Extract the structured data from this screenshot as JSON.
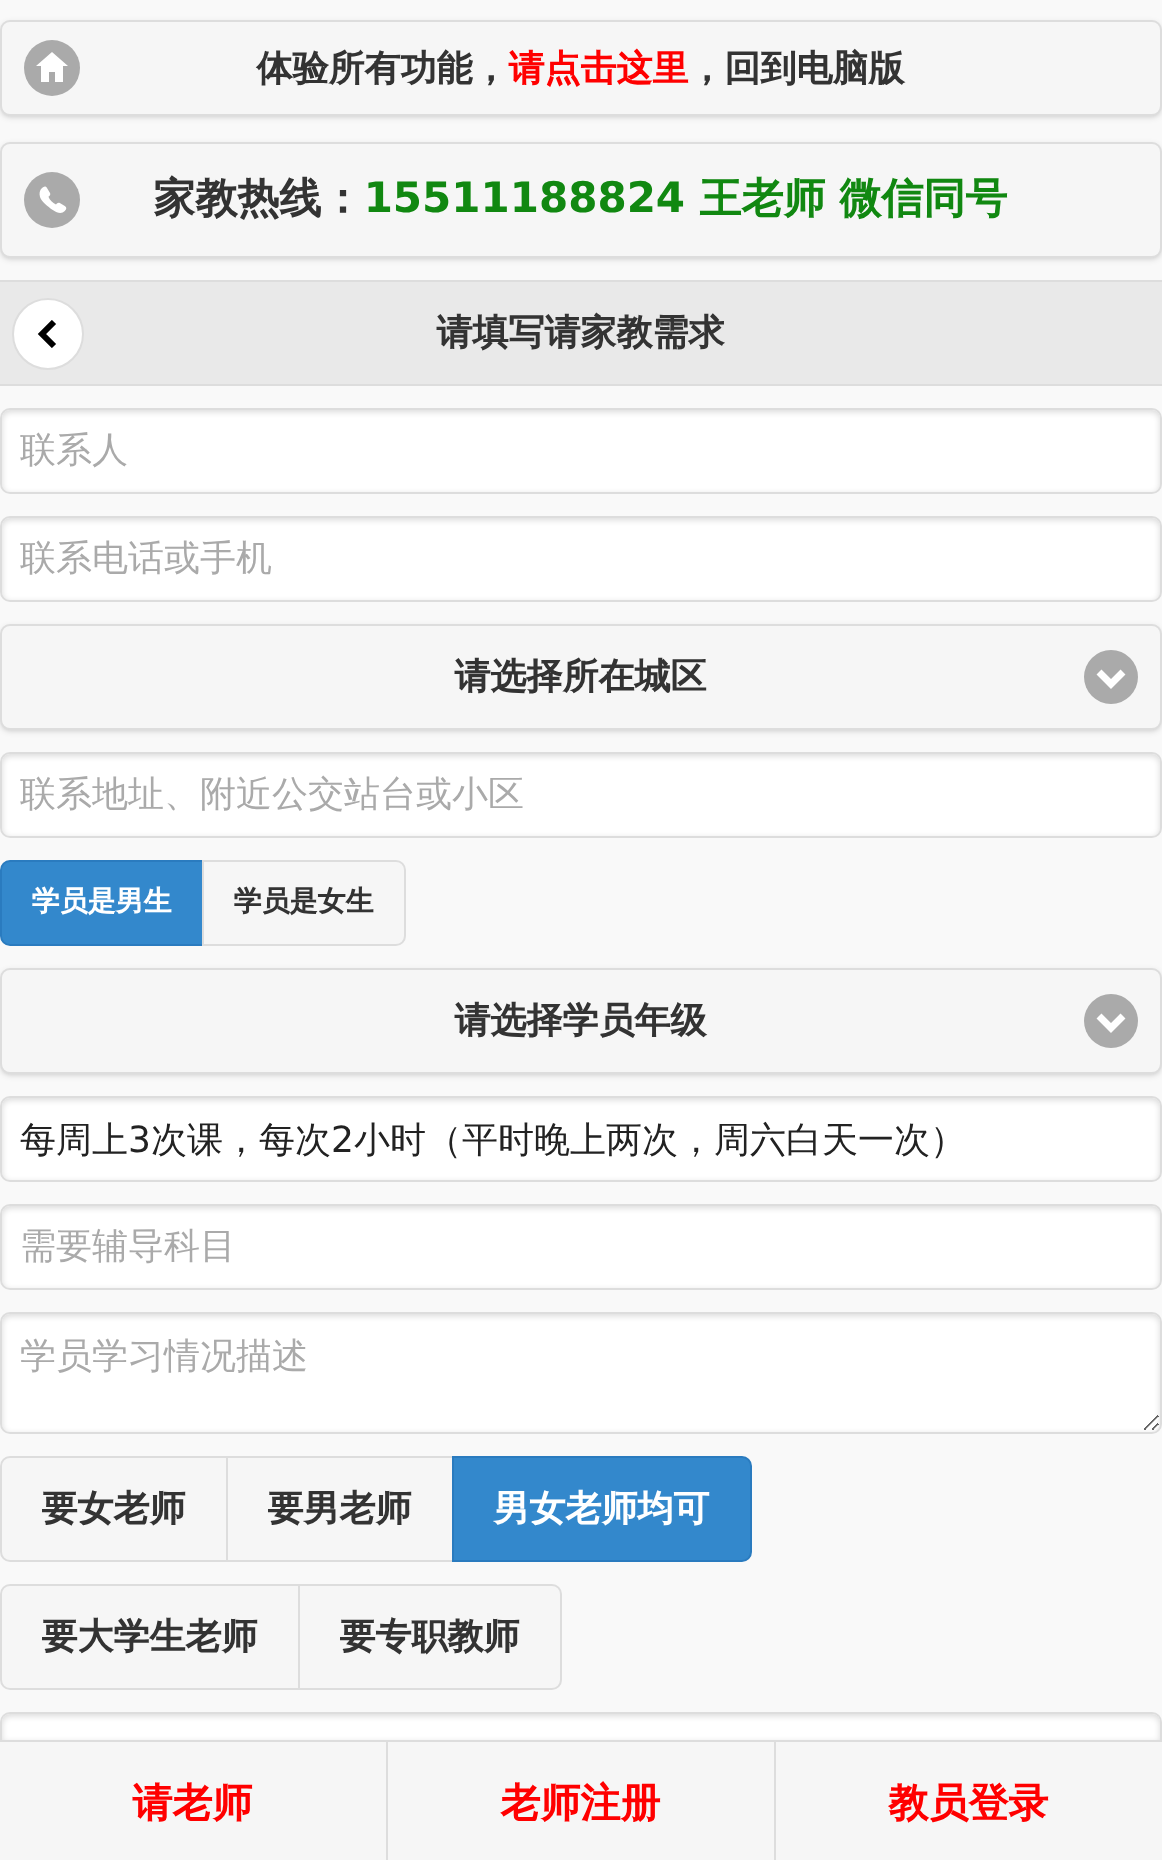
{
  "top_banner": {
    "parts": [
      {
        "kind": "plain",
        "text": "体验所有功能，"
      },
      {
        "kind": "link",
        "text": "请点击这里"
      },
      {
        "kind": "plain",
        "text": "，回到电脑版"
      }
    ]
  },
  "hotline": {
    "label": "家教热线：",
    "value": "15511188824 王老师 微信同号"
  },
  "header": {
    "title": "请填写请家教需求"
  },
  "form_fields": [
    {
      "kind": "input",
      "placeholder": "联系人"
    },
    {
      "kind": "input",
      "placeholder": "联系电话或手机"
    },
    {
      "kind": "select",
      "label": "请选择所在城区"
    },
    {
      "kind": "input",
      "placeholder": "联系地址、附近公交站台或小区"
    },
    {
      "kind": "toggle",
      "options": [
        {
          "label": "学员是男生",
          "selected": true
        },
        {
          "label": "学员是女生",
          "selected": false
        }
      ]
    },
    {
      "kind": "select",
      "label": "请选择学员年级"
    },
    {
      "kind": "input",
      "value": "每周上3次课，每次2小时（平时晚上两次，周六白天一次）"
    },
    {
      "kind": "input",
      "placeholder": "需要辅导科目"
    },
    {
      "kind": "textarea",
      "placeholder": "学员学习情况描述"
    },
    {
      "kind": "toggle",
      "options": [
        {
          "label": "要女老师",
          "selected": false
        },
        {
          "label": "要男老师",
          "selected": false
        },
        {
          "label": "男女老师均可",
          "selected": true
        }
      ]
    },
    {
      "kind": "toggle",
      "options": [
        {
          "label": "要大学生老师",
          "selected": false
        },
        {
          "label": "要专职教师",
          "selected": false
        }
      ]
    },
    {
      "kind": "input"
    }
  ],
  "bottom_nav": [
    {
      "label": "请老师"
    },
    {
      "label": "老师注册"
    },
    {
      "label": "教员登录"
    }
  ]
}
